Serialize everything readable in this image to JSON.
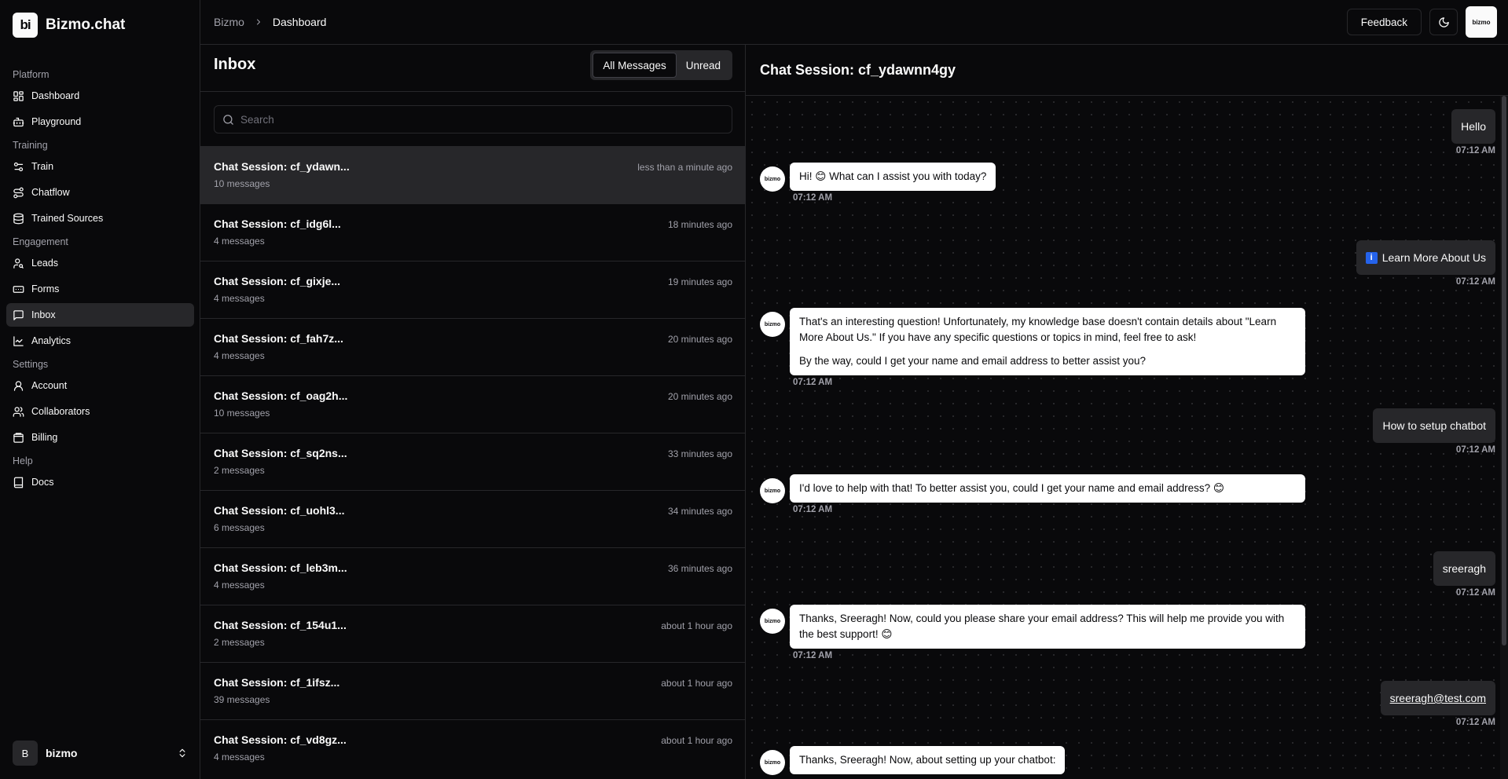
{
  "app": {
    "logo_text": "bi",
    "name": "Bizmo.chat"
  },
  "sidebar": {
    "groups": [
      {
        "label": "Platform",
        "items": [
          {
            "label": "Dashboard",
            "icon": "dashboard-icon"
          },
          {
            "label": "Playground",
            "icon": "bot-icon"
          }
        ]
      },
      {
        "label": "Training",
        "items": [
          {
            "label": "Train",
            "icon": "sliders-icon"
          },
          {
            "label": "Chatflow",
            "icon": "route-icon"
          },
          {
            "label": "Trained Sources",
            "icon": "database-icon"
          }
        ]
      },
      {
        "label": "Engagement",
        "items": [
          {
            "label": "Leads",
            "icon": "user-search-icon"
          },
          {
            "label": "Forms",
            "icon": "form-input-icon"
          },
          {
            "label": "Inbox",
            "icon": "message-square-icon"
          },
          {
            "label": "Analytics",
            "icon": "chart-line-icon"
          }
        ]
      },
      {
        "label": "Settings",
        "items": [
          {
            "label": "Account",
            "icon": "user-icon"
          },
          {
            "label": "Collaborators",
            "icon": "users-icon"
          },
          {
            "label": "Billing",
            "icon": "wallet-icon"
          }
        ]
      },
      {
        "label": "Help",
        "items": [
          {
            "label": "Docs",
            "icon": "book-icon"
          }
        ]
      }
    ],
    "active_item": "Inbox",
    "user": {
      "initial": "B",
      "name": "bizmo"
    }
  },
  "topbar": {
    "breadcrumb": [
      "Bizmo",
      "Dashboard"
    ],
    "feedback_label": "Feedback",
    "avatar_text": "bizmo"
  },
  "inbox": {
    "title": "Inbox",
    "filters": [
      "All Messages",
      "Unread"
    ],
    "active_filter": "All Messages",
    "search_placeholder": "Search",
    "sessions": [
      {
        "title": "Chat Session: cf_ydawn...",
        "count": "10 messages",
        "time": "less than a minute ago"
      },
      {
        "title": "Chat Session: cf_idg6l...",
        "count": "4 messages",
        "time": "18 minutes ago"
      },
      {
        "title": "Chat Session: cf_gixje...",
        "count": "4 messages",
        "time": "19 minutes ago"
      },
      {
        "title": "Chat Session: cf_fah7z...",
        "count": "4 messages",
        "time": "20 minutes ago"
      },
      {
        "title": "Chat Session: cf_oag2h...",
        "count": "10 messages",
        "time": "20 minutes ago"
      },
      {
        "title": "Chat Session: cf_sq2ns...",
        "count": "2 messages",
        "time": "33 minutes ago"
      },
      {
        "title": "Chat Session: cf_uohl3...",
        "count": "6 messages",
        "time": "34 minutes ago"
      },
      {
        "title": "Chat Session: cf_leb3m...",
        "count": "4 messages",
        "time": "36 minutes ago"
      },
      {
        "title": "Chat Session: cf_154u1...",
        "count": "2 messages",
        "time": "about 1 hour ago"
      },
      {
        "title": "Chat Session: cf_1ifsz...",
        "count": "39 messages",
        "time": "about 1 hour ago"
      },
      {
        "title": "Chat Session: cf_vd8gz...",
        "count": "4 messages",
        "time": "about 1 hour ago"
      }
    ]
  },
  "chat": {
    "title": "Chat Session: cf_ydawnn4gy",
    "bot_avatar_text": "bizmo",
    "messages": [
      {
        "role": "user",
        "text": "Hello",
        "time": "07:12 AM"
      },
      {
        "role": "bot",
        "paragraphs": [
          "Hi! 😊 What can I assist you with today?"
        ],
        "time": "07:12 AM"
      },
      {
        "role": "user",
        "badge": "i",
        "text": "Learn More About Us",
        "time": "07:12 AM"
      },
      {
        "role": "bot",
        "paragraphs": [
          "That's an interesting question! Unfortunately, my knowledge base doesn't contain details about \"Learn More About Us.\" If you have any specific questions or topics in mind, feel free to ask!",
          "By the way, could I get your name and email address to better assist you?"
        ],
        "time": "07:12 AM"
      },
      {
        "role": "user",
        "text": "How to setup chatbot",
        "time": "07:12 AM"
      },
      {
        "role": "bot",
        "paragraphs": [
          "I'd love to help with that! To better assist you, could I get your name and email address? 😊"
        ],
        "time": "07:12 AM"
      },
      {
        "role": "user",
        "text": "sreeragh",
        "time": "07:12 AM"
      },
      {
        "role": "bot",
        "paragraphs": [
          "Thanks, Sreeragh! Now, could you please share your email address? This will help me provide you with the best support! 😊"
        ],
        "time": "07:12 AM"
      },
      {
        "role": "user",
        "text": "sreeragh@test.com",
        "time": "07:12 AM"
      },
      {
        "role": "bot",
        "paragraphs": [
          "Thanks, Sreeragh! Now, about setting up your chatbot:"
        ],
        "time": ""
      }
    ]
  }
}
